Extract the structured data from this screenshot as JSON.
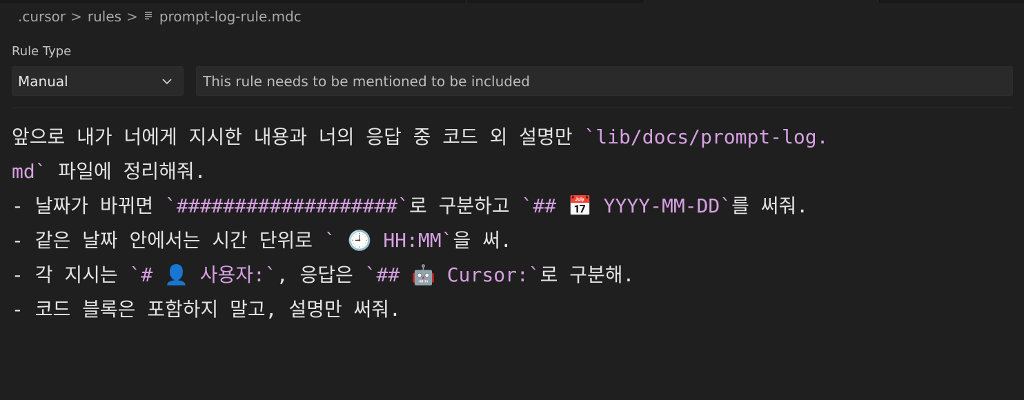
{
  "breadcrumb": {
    "segments": [
      ".cursor",
      "rules"
    ],
    "separator": ">",
    "file": "prompt-log-rule.mdc"
  },
  "rule_type": {
    "label": "Rule Type",
    "selected": "Manual",
    "description_placeholder": "This rule needs to be mentioned to be included"
  },
  "colors": {
    "background": "#1f1f1f",
    "inline_code": "#d7a0e3",
    "text": "#e4e4e4"
  },
  "editor": {
    "lines": [
      [
        {
          "text": "앞으로 내가 너에게 지시한 내용과 너의 응답 중 코드 외 설명만 "
        },
        {
          "text": "`lib/docs/prompt-log.",
          "code": true
        }
      ],
      [
        {
          "text": "md`",
          "code": true
        },
        {
          "text": " 파일에 정리해줘."
        }
      ],
      [
        {
          "text": "- 날짜가 바뀌면 "
        },
        {
          "text": "`###################`",
          "code": true
        },
        {
          "text": "로 구분하고 "
        },
        {
          "text": "`## 📅 YYYY-MM-DD`",
          "code": true
        },
        {
          "text": "를 써줘."
        }
      ],
      [
        {
          "text": "- 같은 날짜 안에서는 시간 단위로 "
        },
        {
          "text": "` 🕘 HH:MM`",
          "code": true
        },
        {
          "text": "을 써."
        }
      ],
      [
        {
          "text": "- 각 지시는 "
        },
        {
          "text": "`# 👤 사용자:`",
          "code": true
        },
        {
          "text": ", 응답은 "
        },
        {
          "text": "`## 🤖 Cursor:`",
          "code": true
        },
        {
          "text": "로 구분해."
        }
      ],
      [
        {
          "text": "- 코드 블록은 포함하지 말고, 설명만 써줘."
        }
      ]
    ]
  }
}
